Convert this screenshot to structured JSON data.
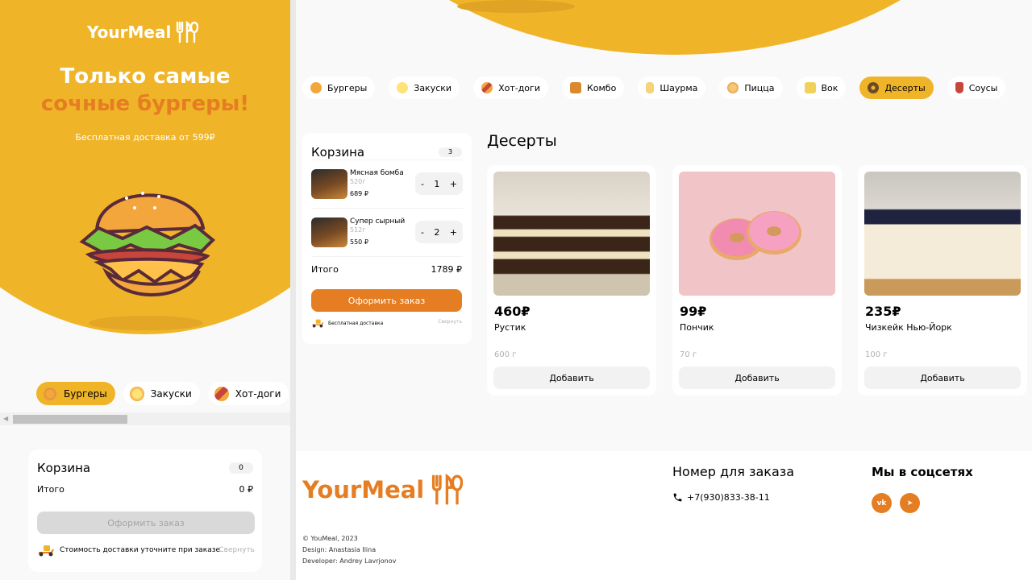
{
  "brand": {
    "name": "YourMeal"
  },
  "hero": {
    "line1": "Только самые",
    "line2": "сочные бургеры!",
    "free_delivery": "Бесплатная доставка от 599₽"
  },
  "mobile": {
    "categories": [
      {
        "label": "Бургеры",
        "icon": "burger-icon",
        "active": true
      },
      {
        "label": "Закуски",
        "icon": "snacks-icon",
        "active": false
      },
      {
        "label": "Хот-доги",
        "icon": "hotdog-icon",
        "active": false
      }
    ],
    "cart": {
      "title": "Корзина",
      "count": "0",
      "total_label": "Итого",
      "total_value": "0 ₽",
      "order_label": "Оформить заказ",
      "delivery_note": "Стоимость доставки уточните при заказе",
      "collapse_label": "Свернуть"
    }
  },
  "desktop": {
    "categories": [
      {
        "label": "Бургеры",
        "icon": "burger-icon",
        "active": false
      },
      {
        "label": "Закуски",
        "icon": "snacks-icon",
        "active": false
      },
      {
        "label": "Хот-доги",
        "icon": "hotdog-icon",
        "active": false
      },
      {
        "label": "Комбо",
        "icon": "combo-icon",
        "active": false
      },
      {
        "label": "Шаурма",
        "icon": "shawarma-icon",
        "active": false
      },
      {
        "label": "Пицца",
        "icon": "pizza-icon",
        "active": false
      },
      {
        "label": "Вок",
        "icon": "wok-icon",
        "active": false
      },
      {
        "label": "Десерты",
        "icon": "donut-icon",
        "active": true
      },
      {
        "label": "Соусы",
        "icon": "sauce-icon",
        "active": false
      }
    ],
    "cart": {
      "title": "Корзина",
      "count": "3",
      "items": [
        {
          "name": "Мясная бомба",
          "weight": "520г",
          "price": "689 ₽",
          "qty": "1"
        },
        {
          "name": "Супер сырный",
          "weight": "512г",
          "price": "550 ₽",
          "qty": "2"
        }
      ],
      "total_label": "Итого",
      "total_value": "1789 ₽",
      "order_label": "Оформить заказ",
      "delivery_note": "Бесплатная доставка",
      "collapse_label": "Свернуть"
    },
    "section_title": "Десерты",
    "products": [
      {
        "price": "460₽",
        "name": "Рустик",
        "weight": "600 г",
        "add_label": "Добавить",
        "image": "cake"
      },
      {
        "price": "99₽",
        "name": "Пончик",
        "weight": "70 г",
        "add_label": "Добавить",
        "image": "donut"
      },
      {
        "price": "235₽",
        "name": "Чизкейк Нью-Йорк",
        "weight": "100 г",
        "add_label": "Добавить",
        "image": "cheesecake"
      }
    ]
  },
  "footer": {
    "copyright": "© YouMeal, 2023",
    "design": "Design: Anastasia Ilina",
    "developer": "Developer: Andrey Lavrjonov",
    "phone_heading": "Номер для заказа",
    "phone": "+7(930)833-38-11",
    "social_heading": "Мы в соцсетях",
    "social": [
      "vk",
      "telegram"
    ]
  },
  "colors": {
    "yellow": "#f0b428",
    "orange": "#e57d22",
    "light": "#f2f2f3"
  }
}
